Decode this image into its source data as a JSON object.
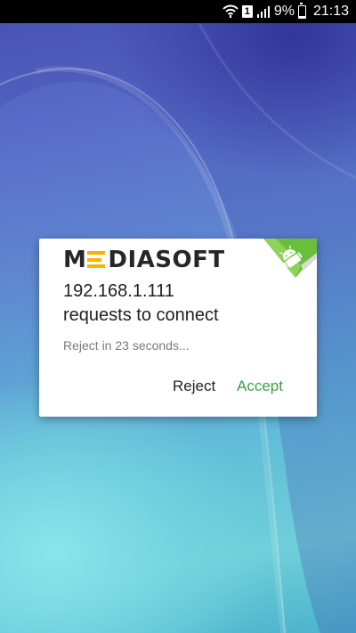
{
  "status_bar": {
    "icons": [
      "wifi-icon",
      "sim-icon",
      "signal-icon",
      "battery-icon"
    ],
    "sim_label": "1",
    "battery_percent": "9%",
    "battery_level": 0.09,
    "time": "21:13"
  },
  "dialog": {
    "logo": {
      "prefix": "M",
      "suffix": "DIASOFT",
      "accent_color": "#ffb000"
    },
    "badge_icon": "android-icon",
    "badge_color": "#6abf3a",
    "title_line1": "192.168.1.111",
    "title_line2": "requests to connect",
    "countdown_text": "Reject in 23 seconds...",
    "reject_label": "Reject",
    "accept_label": "Accept",
    "accept_color": "#3c9e47"
  }
}
